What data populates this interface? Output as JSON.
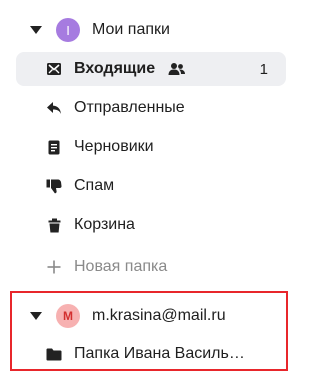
{
  "accounts": [
    {
      "name": "Мои папки",
      "avatar_letter": "I",
      "avatar_color": "#a67be0",
      "folders": [
        {
          "label": "Входящие",
          "count": "1",
          "selected": true,
          "icon": "inbox-icon"
        },
        {
          "label": "Отправленные",
          "icon": "reply-icon"
        },
        {
          "label": "Черновики",
          "icon": "draft-icon"
        },
        {
          "label": "Спам",
          "icon": "thumbs-down-icon"
        },
        {
          "label": "Корзина",
          "icon": "trash-icon"
        }
      ],
      "new_folder_label": "Новая папка"
    },
    {
      "name": "m.krasina@mail.ru",
      "avatar_letter": "M",
      "avatar_color": "#f7b1b1",
      "folders": [
        {
          "label": "Папка Ивана Василь…",
          "icon": "folder-icon"
        }
      ]
    }
  ],
  "highlight_color": "#e8262b"
}
